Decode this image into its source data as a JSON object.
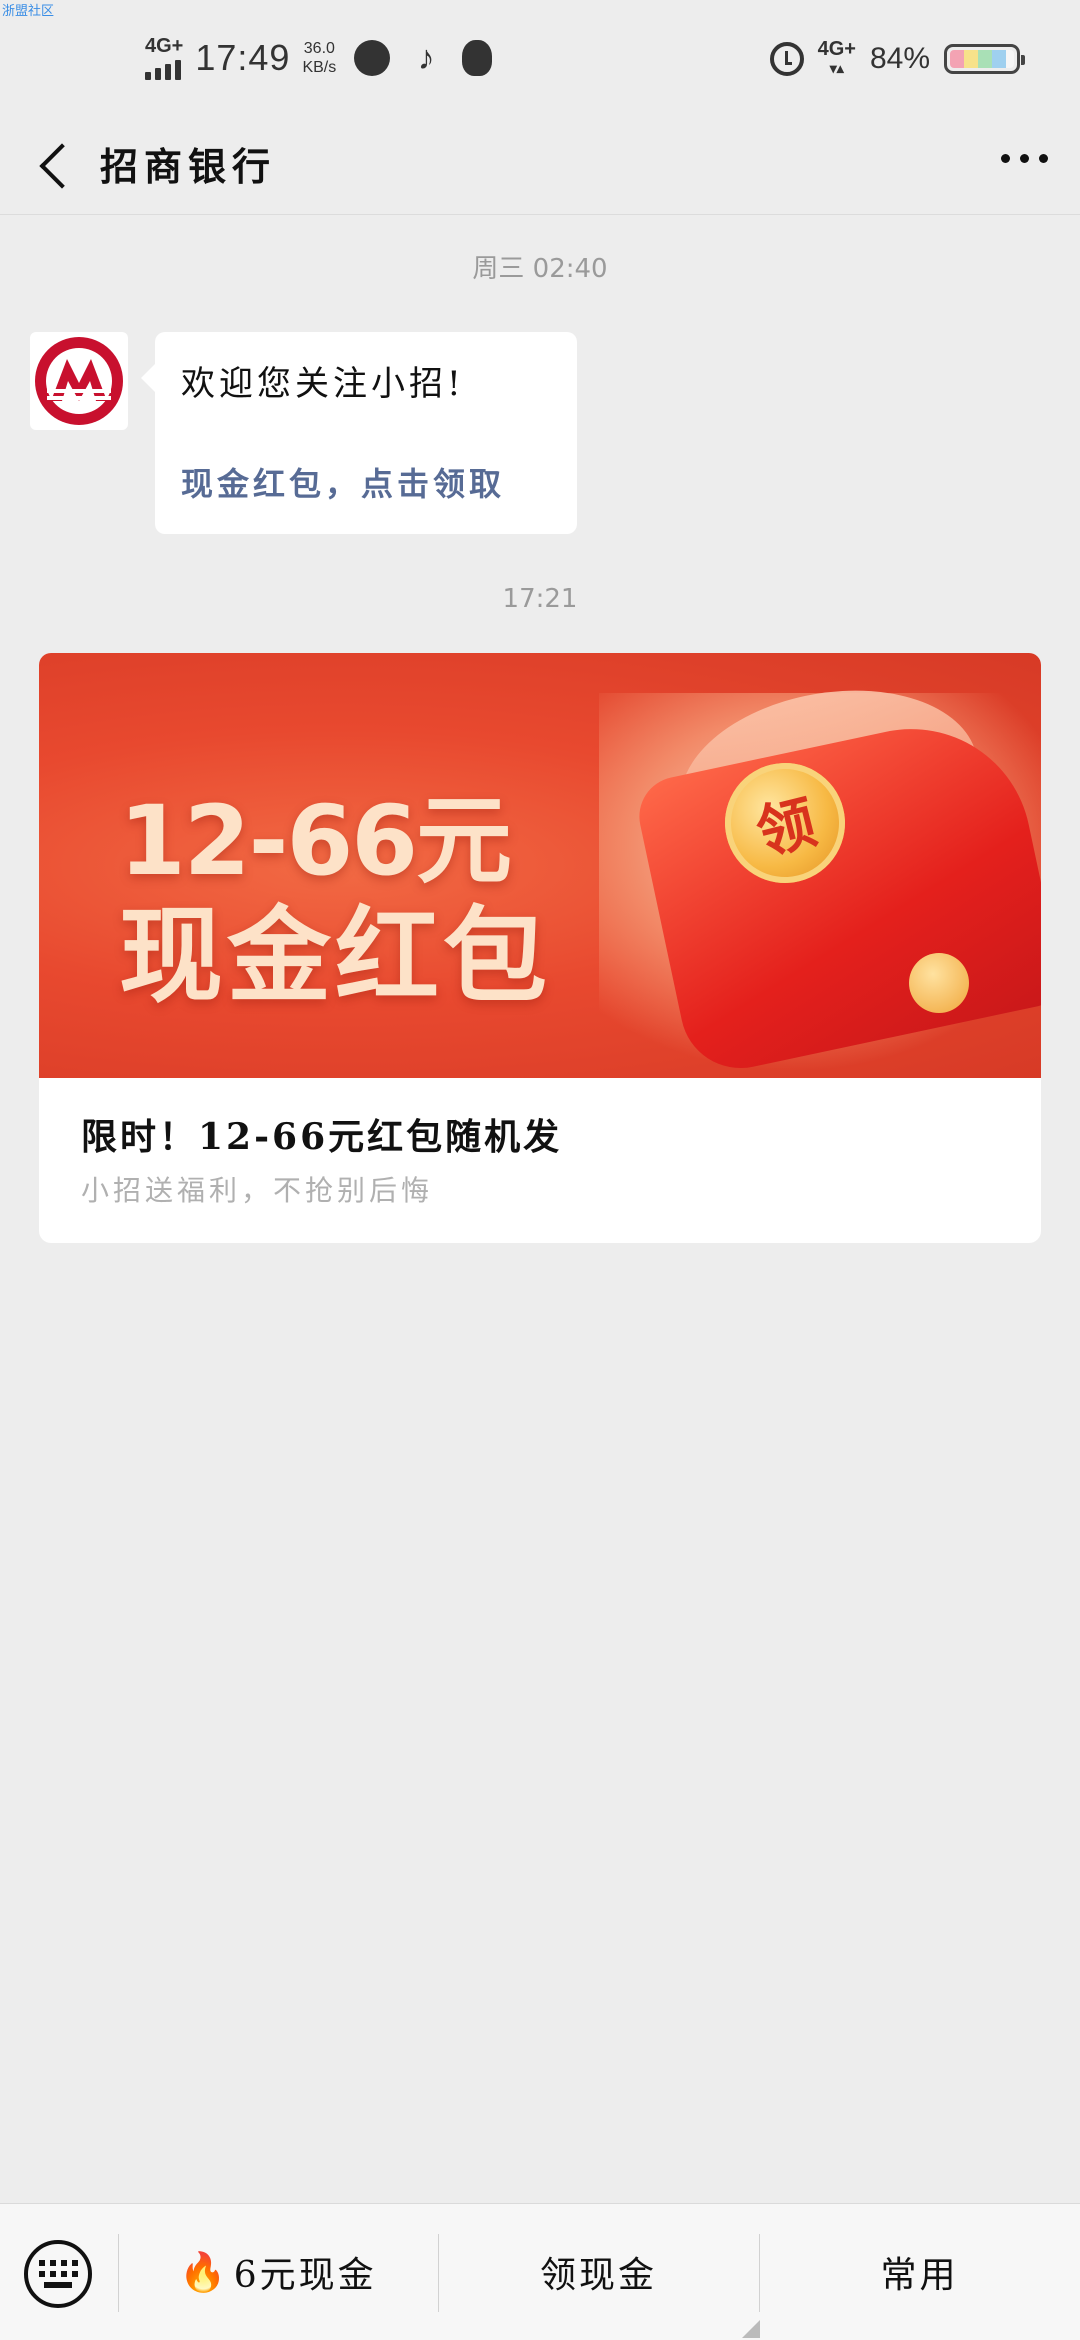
{
  "watermark": "浙盟社区",
  "status_bar": {
    "network_left": "4G+",
    "time": "17:49",
    "speed_value": "36.0",
    "speed_unit": "KB/s",
    "app_icons": [
      "speedometer-icon",
      "tiktok-icon",
      "qq-penguin-icon"
    ],
    "alarm_icon": "alarm-icon",
    "network_right": "4G+",
    "battery_percent": "84%",
    "battery_level": 0.84
  },
  "header": {
    "back_icon": "chevron-left-icon",
    "title": "招商银行",
    "more_icon": "more-dots-icon"
  },
  "chat": {
    "timestamp_1": "周三 02:40",
    "message": {
      "line1": "欢迎您关注小招!",
      "link": "现金红包，点击领取"
    },
    "timestamp_2": "17:21",
    "card": {
      "banner_line1": "12-66元",
      "banner_line2": "现金红包",
      "coin_char": "领",
      "title": "限时！12-66元红包随机发",
      "subtitle": "小招送福利，不抢别后悔"
    }
  },
  "bottom_bar": {
    "keyboard_icon": "keyboard-icon",
    "menu1_icon": "fire-emoji",
    "menu1_label": "6元现金",
    "menu2_label": "领现金",
    "menu3_label": "常用"
  },
  "colors": {
    "link": "#576b95",
    "banner_red": "#e8492f",
    "background": "#ededed"
  }
}
